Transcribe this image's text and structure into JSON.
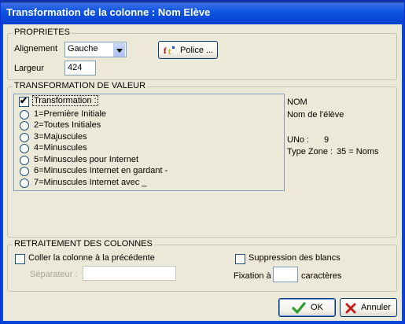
{
  "window": {
    "title": "Transformation de la colonne : Nom Elève"
  },
  "proprietes": {
    "legend": "PROPRIETES",
    "alignement_label": "Alignement",
    "alignement_value": "Gauche",
    "largeur_label": "Largeur",
    "largeur_value": "424",
    "police_button": "Police ..."
  },
  "transformation": {
    "legend": "TRANSFORMATION DE VALEUR",
    "checkbox_label": "Transformation :",
    "checkbox_checked": true,
    "options": [
      "1=Première Initiale",
      "2=Toutes Initiales",
      "3=Majuscules",
      "4=Minuscules",
      "5=Minuscules pour Internet",
      "6=Minuscules Internet en gardant -",
      "7=Minuscules Internet avec _"
    ],
    "info": {
      "name": "NOM",
      "description": "Nom de l'élève",
      "uno_label": "UNo :",
      "uno_value": "9",
      "type_label": "Type Zone :",
      "type_value": "35 = Noms"
    }
  },
  "retraitement": {
    "legend": "RETRAITEMENT DES COLONNES",
    "coller_label": "Coller la colonne à la précédente",
    "separateur_label": "Séparateur :",
    "separateur_value": "",
    "suppression_label": "Suppression des blancs",
    "fixation_label": "Fixation à",
    "fixation_value": "",
    "caracteres_label": "caractères"
  },
  "buttons": {
    "ok": "OK",
    "cancel": "Annuler"
  },
  "colors": {
    "titlebar": "#0a46d8",
    "ok_check": "#2a9d2a",
    "cancel_x": "#c81e1e"
  }
}
